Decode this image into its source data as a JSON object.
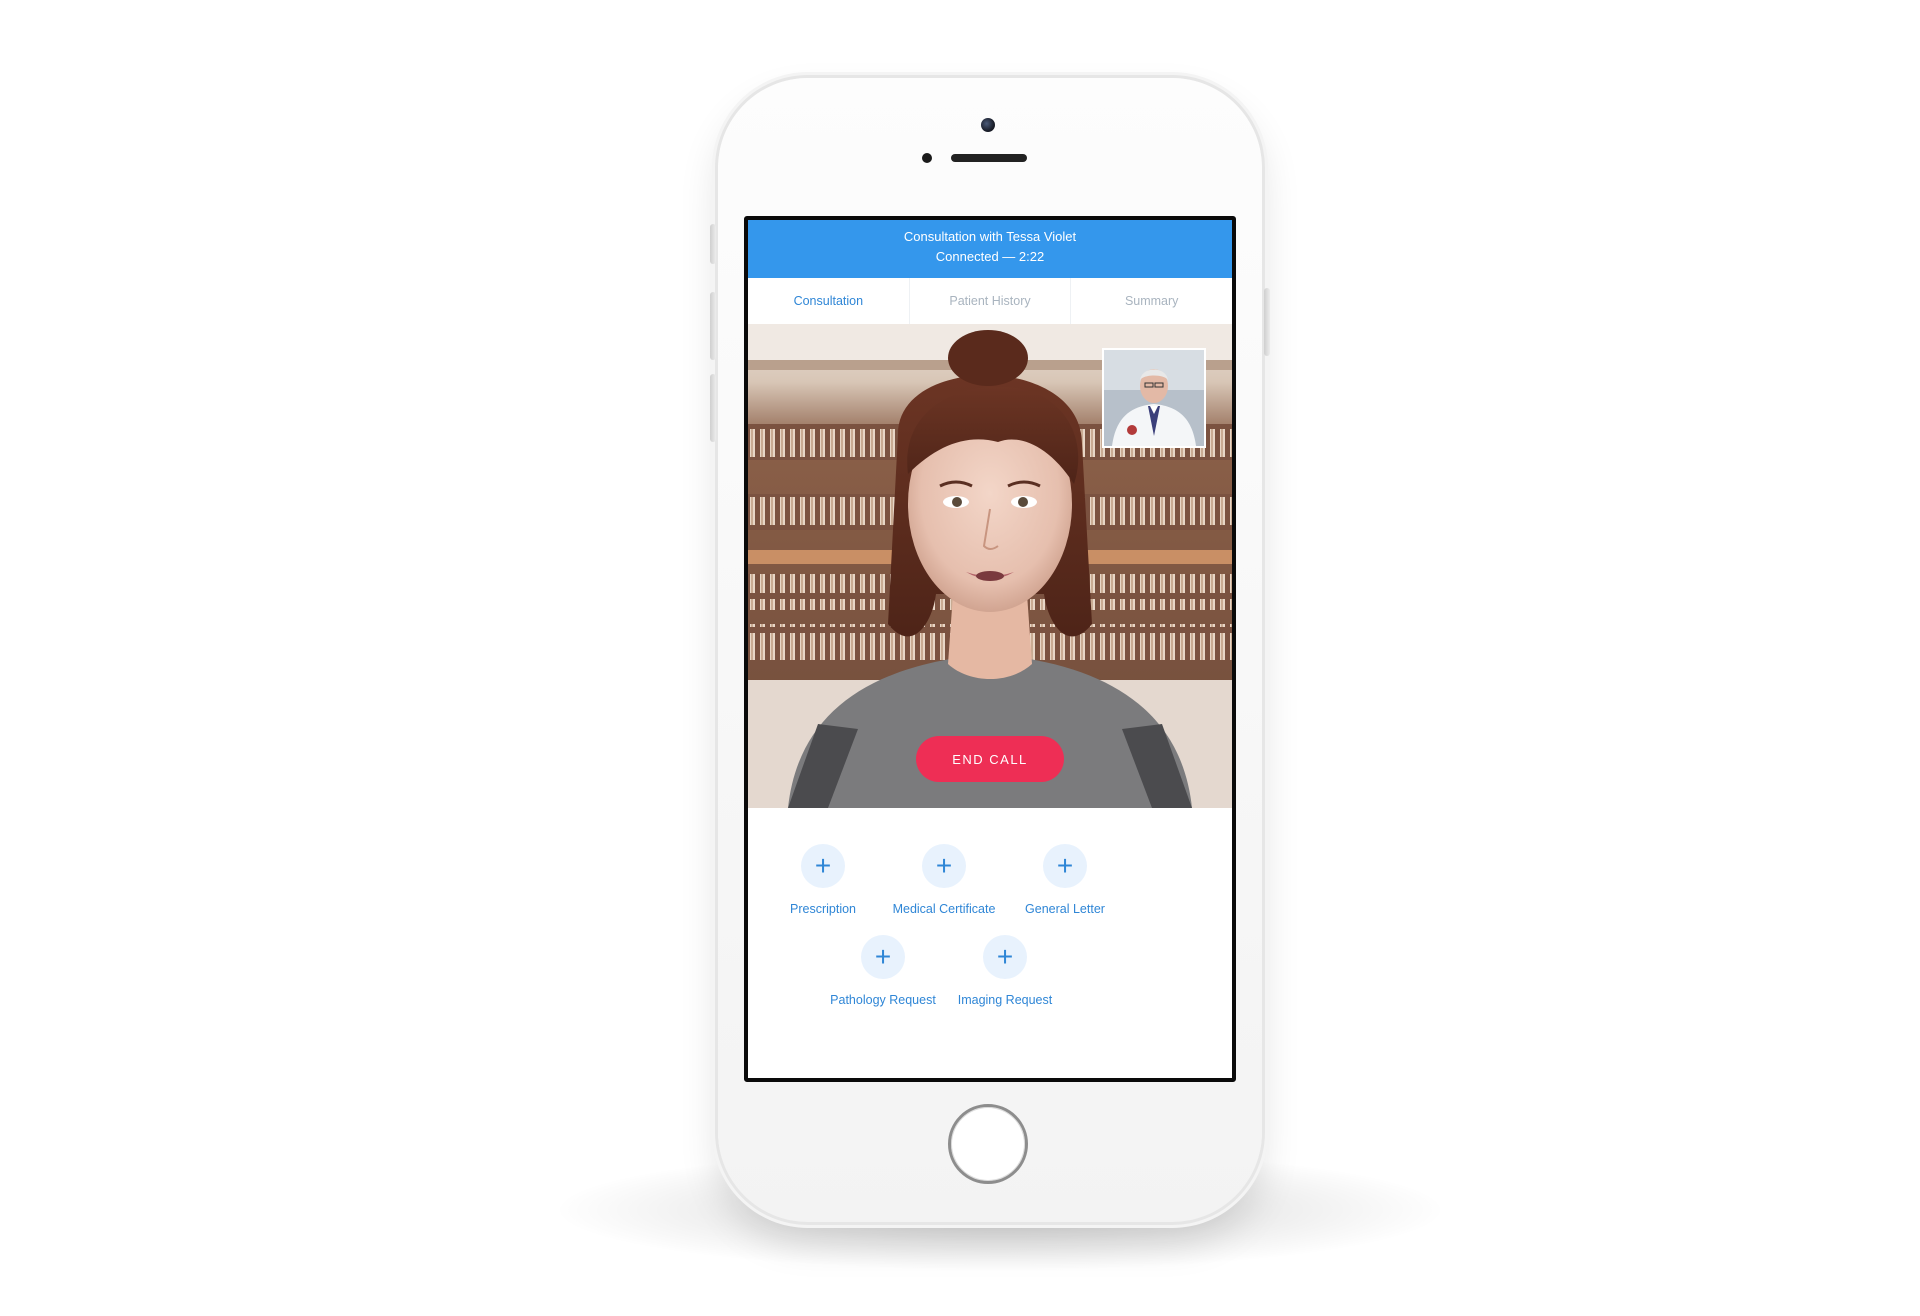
{
  "header": {
    "title": "Consultation with Tessa Violet",
    "status": "Connected — 2:22"
  },
  "tabs": [
    {
      "label": "Consultation",
      "active": true
    },
    {
      "label": "Patient History",
      "active": false
    },
    {
      "label": "Summary",
      "active": false
    }
  ],
  "call": {
    "end_label": "END CALL"
  },
  "actions": [
    {
      "label": "Prescription",
      "icon": "plus-icon"
    },
    {
      "label": "Medical Certificate",
      "icon": "plus-icon"
    },
    {
      "label": "General Letter",
      "icon": "plus-icon"
    },
    {
      "label": "Pathology Request",
      "icon": "plus-icon"
    },
    {
      "label": "Imaging Request",
      "icon": "plus-icon"
    }
  ],
  "colors": {
    "brand_blue": "#3497ec",
    "accent_text": "#2f86d6",
    "end_call_red": "#ee2e55"
  }
}
